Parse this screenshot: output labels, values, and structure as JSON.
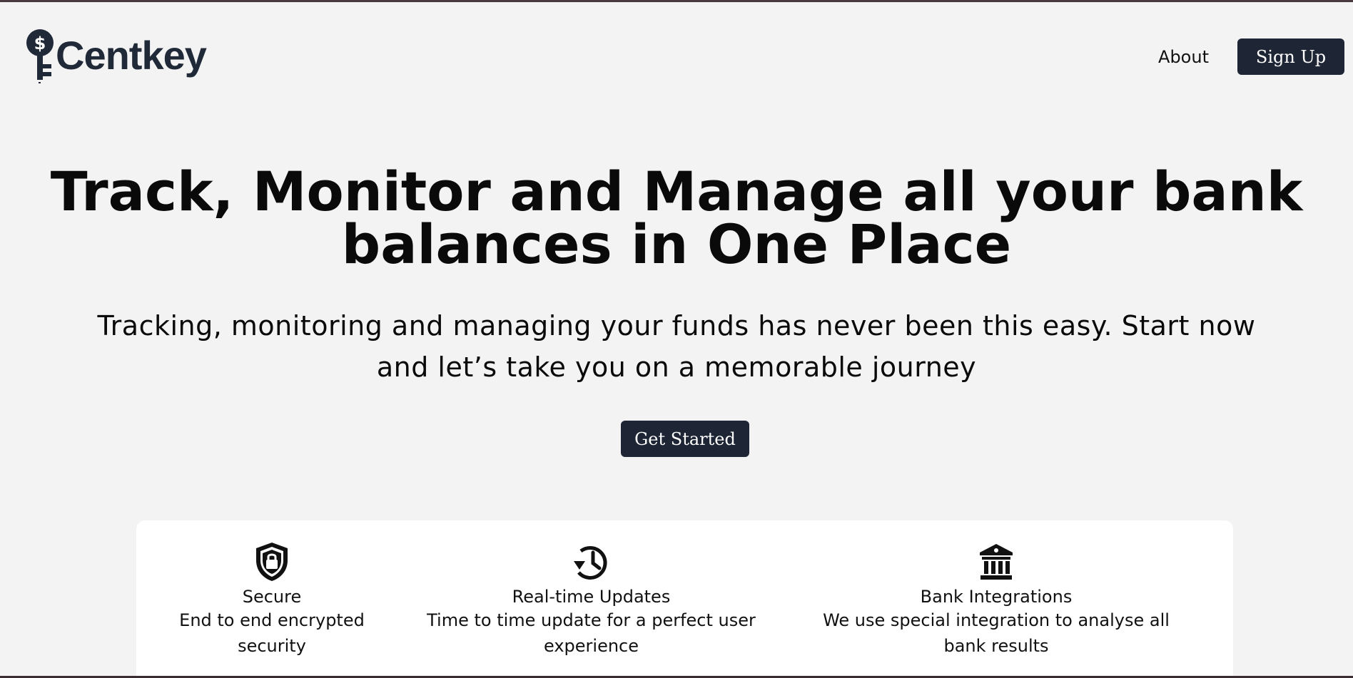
{
  "brand": {
    "name": "Centkey",
    "icon": "dollar-key-icon"
  },
  "nav": {
    "about_label": "About",
    "signup_label": "Sign Up"
  },
  "hero": {
    "title_line1": "Track, Monitor and Manage all your bank",
    "title_line2": "balances in One Place",
    "subtitle": "Tracking, monitoring and managing your funds has never been this easy. Start now and let’s take you on a memorable journey",
    "cta_label": "Get Started"
  },
  "features": [
    {
      "icon": "shield-lock-icon",
      "title": "Secure",
      "description": "End to end encrypted security"
    },
    {
      "icon": "history-clock-icon",
      "title": "Real-time Updates",
      "description": "Time to time update for a perfect user experience"
    },
    {
      "icon": "bank-icon",
      "title": "Bank Integrations",
      "description": "We use special integration to analyse all bank results"
    }
  ],
  "colors": {
    "background": "#f3f3f3",
    "button": "#1e2535",
    "brand_text": "#1f2937",
    "card": "#ffffff"
  }
}
